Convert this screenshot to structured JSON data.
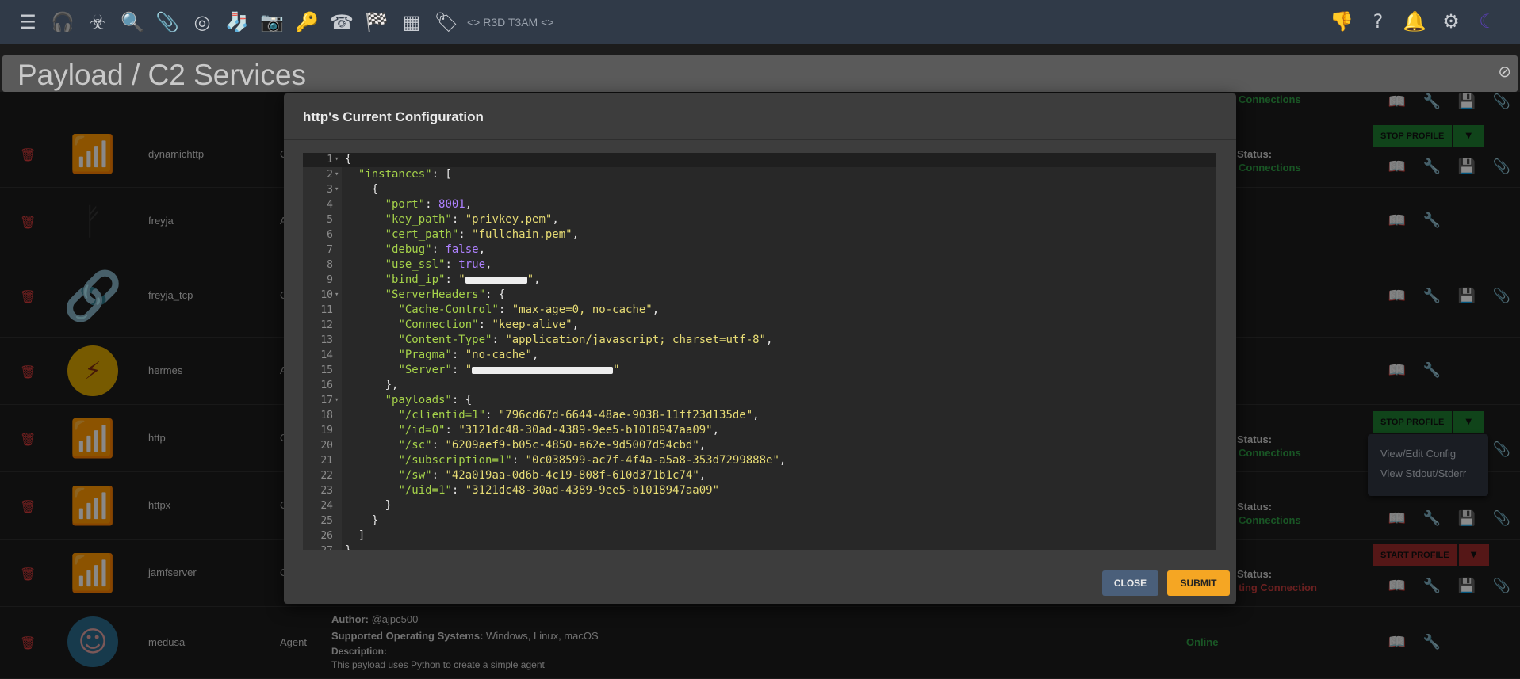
{
  "topbar": {
    "icons": [
      "menu-icon",
      "headset-icon",
      "biohazard-icon",
      "search-icon",
      "paperclip-icon",
      "fingerprint-icon",
      "socks-icon",
      "camera-icon",
      "key-icon",
      "phone-callback-icon",
      "flag-checkered-icon",
      "table-icon",
      "tag-icon"
    ],
    "brand": "<> R3D T3AM <>",
    "right_icons": [
      "feedback-icon",
      "help-icon",
      "bell-icon",
      "user-settings-icon",
      "moon-icon"
    ]
  },
  "page_title": "Payload / C2 Services",
  "rows": [
    {
      "name": "dynamichttp",
      "kind": "C",
      "status_label": "Status:",
      "status_value": "Connections",
      "status_color": "#2e9d44",
      "profile_button": "STOP PROFILE"
    },
    {
      "name": "freyja",
      "kind": "A"
    },
    {
      "name": "freyja_tcp",
      "kind": "C"
    },
    {
      "name": "hermes",
      "kind": "A"
    },
    {
      "name": "http",
      "kind": "C",
      "status_label": "Status:",
      "status_value": "Connections",
      "profile_button": "STOP PROFILE"
    },
    {
      "name": "httpx",
      "kind": "C",
      "status_label": "Status:",
      "status_value": "Connections"
    },
    {
      "name": "jamfserver",
      "kind": "C",
      "status_label": "Status:",
      "status_value": "ting Connection",
      "status_color": "#c43b3b",
      "profile_button": "START PROFILE"
    },
    {
      "name": "medusa",
      "kind": "Agent",
      "status_value": "Online"
    }
  ],
  "top_partial_status": "Connections",
  "medusa": {
    "author_label": "Author:",
    "author": "@ajpc500",
    "os_label": "Supported Operating Systems:",
    "os": "Windows, Linux, macOS",
    "desc_label": "Description:",
    "desc": "This payload uses Python to create a simple agent"
  },
  "dropdown_menu": [
    "View/Edit Config",
    "View Stdout/Stderr"
  ],
  "modal": {
    "title": "http's Current Configuration",
    "close_label": "CLOSE",
    "submit_label": "SUBMIT",
    "code_lines": [
      {
        "n": "1",
        "fold": true,
        "html": "{"
      },
      {
        "n": "2",
        "fold": true,
        "html": "  <span class='k'>\"instances\"</span>: ["
      },
      {
        "n": "3",
        "fold": true,
        "html": "    {"
      },
      {
        "n": "4",
        "html": "      <span class='k'>\"port\"</span>: <span class='n'>8001</span>,"
      },
      {
        "n": "5",
        "html": "      <span class='k'>\"key_path\"</span>: <span class='s'>\"privkey.pem\"</span>,"
      },
      {
        "n": "6",
        "html": "      <span class='k'>\"cert_path\"</span>: <span class='s'>\"fullchain.pem\"</span>,"
      },
      {
        "n": "7",
        "html": "      <span class='k'>\"debug\"</span>: <span class='n'>false</span>,"
      },
      {
        "n": "8",
        "html": "      <span class='k'>\"use_ssl\"</span>: <span class='n'>true</span>,"
      },
      {
        "n": "9",
        "html": "      <span class='k'>\"bind_ip\"</span>: <span class='s'>\"<span class='red-mark' style='width:78px'></span>\"</span>,"
      },
      {
        "n": "10",
        "fold": true,
        "html": "      <span class='k'>\"ServerHeaders\"</span>: {"
      },
      {
        "n": "11",
        "html": "        <span class='k'>\"Cache-Control\"</span>: <span class='s'>\"max-age=0, no-cache\"</span>,"
      },
      {
        "n": "12",
        "html": "        <span class='k'>\"Connection\"</span>: <span class='s'>\"keep-alive\"</span>,"
      },
      {
        "n": "13",
        "html": "        <span class='k'>\"Content-Type\"</span>: <span class='s'>\"application/javascript; charset=utf-8\"</span>,"
      },
      {
        "n": "14",
        "html": "        <span class='k'>\"Pragma\"</span>: <span class='s'>\"no-cache\"</span>,"
      },
      {
        "n": "15",
        "html": "        <span class='k'>\"Server\"</span>: <span class='s'>\"<span class='red-mark' style='width:178px'></span>\"</span>"
      },
      {
        "n": "16",
        "html": "      },"
      },
      {
        "n": "17",
        "fold": true,
        "html": "      <span class='k'>\"payloads\"</span>: {"
      },
      {
        "n": "18",
        "html": "        <span class='k'>\"/clientid=1\"</span>: <span class='s'>\"796cd67d-6644-48ae-9038-11ff23d135de\"</span>,"
      },
      {
        "n": "19",
        "html": "        <span class='k'>\"/id=0\"</span>: <span class='s'>\"3121dc48-30ad-4389-9ee5-b1018947aa09\"</span>,"
      },
      {
        "n": "20",
        "html": "        <span class='k'>\"/sc\"</span>: <span class='s'>\"6209aef9-b05c-4850-a62e-9d5007d54cbd\"</span>,"
      },
      {
        "n": "21",
        "html": "        <span class='k'>\"/subscription=1\"</span>: <span class='s'>\"0c038599-ac7f-4f4a-a5a8-353d7299888e\"</span>,"
      },
      {
        "n": "22",
        "html": "        <span class='k'>\"/sw\"</span>: <span class='s'>\"42a019aa-0d6b-4c19-808f-610d371b1c74\"</span>,"
      },
      {
        "n": "23",
        "html": "        <span class='k'>\"/uid=1\"</span>: <span class='s'>\"3121dc48-30ad-4389-9ee5-b1018947aa09\"</span>"
      },
      {
        "n": "24",
        "html": "      }"
      },
      {
        "n": "25",
        "html": "    }"
      },
      {
        "n": "26",
        "html": "  ]"
      },
      {
        "n": "27",
        "html": "}"
      }
    ]
  },
  "colors": {
    "accent_green": "#1e7d30",
    "accent_red": "#9b2b2b",
    "submit": "#f5a623",
    "close": "#4a5f7a"
  }
}
